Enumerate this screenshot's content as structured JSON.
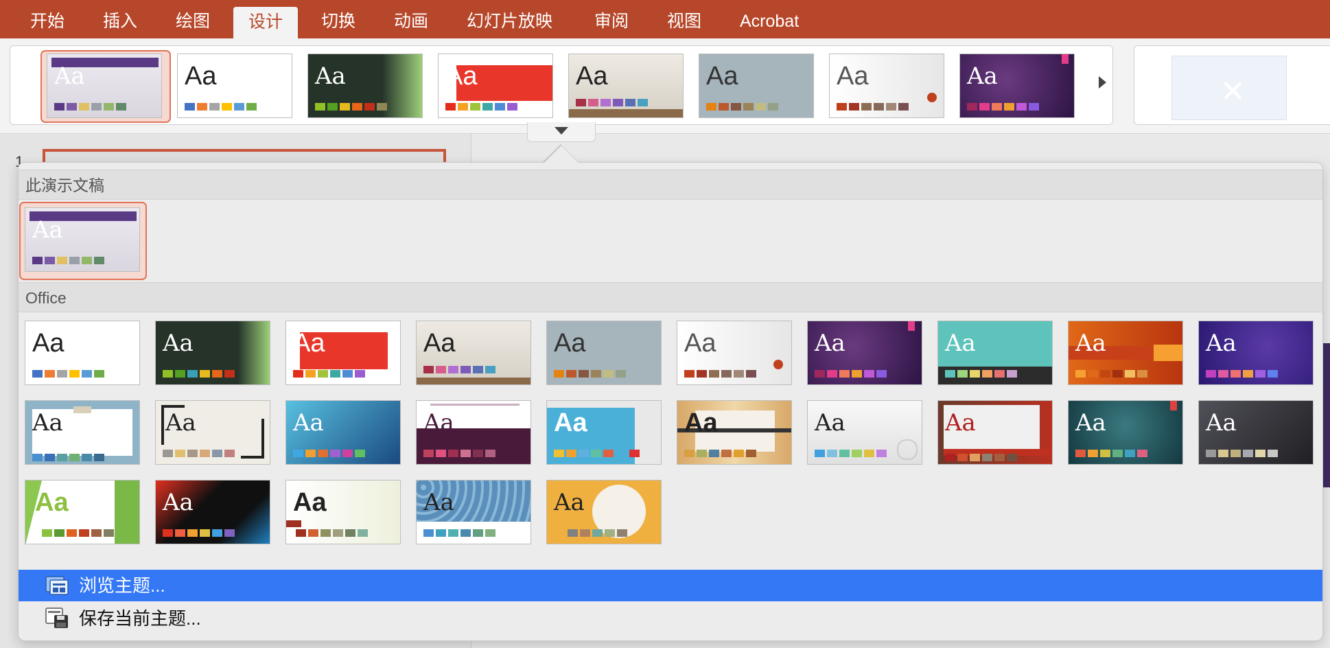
{
  "tabs": [
    {
      "label": "开始",
      "active": false
    },
    {
      "label": "插入",
      "active": false
    },
    {
      "label": "绘图",
      "active": false
    },
    {
      "label": "设计",
      "active": true
    },
    {
      "label": "切换",
      "active": false
    },
    {
      "label": "动画",
      "active": false
    },
    {
      "label": "幻灯片放映",
      "active": false
    },
    {
      "label": "审阅",
      "active": false
    },
    {
      "label": "视图",
      "active": false
    },
    {
      "label": "Acrobat",
      "active": false
    }
  ],
  "slide_panel": {
    "slide_number": "1"
  },
  "gallery": {
    "aa_text": "Aa",
    "section_current": "此演示文稿",
    "section_office": "Office",
    "menu": {
      "browse": "浏览主题...",
      "save": "保存当前主题..."
    }
  },
  "colors": {
    "ribbon_accent": "#b7472a",
    "selection_border": "#e07358",
    "menu_highlight": "#3478f6"
  },
  "icons": [
    "scroll-right-icon",
    "expand-gallery-icon",
    "browse-themes-icon",
    "save-theme-icon",
    "variant-close-icon"
  ]
}
